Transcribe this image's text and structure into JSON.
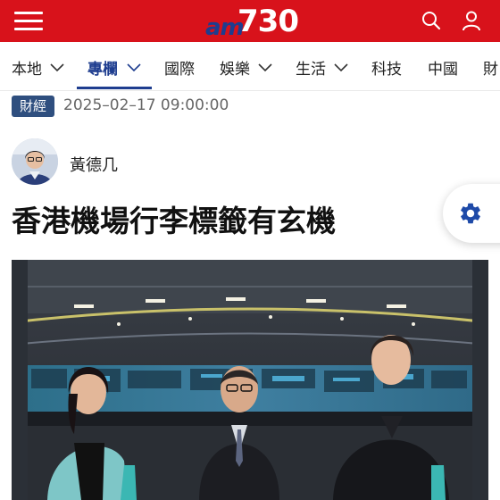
{
  "header": {
    "logo_prefix": "am",
    "logo_number": "730",
    "menu_icon": "hamburger-icon",
    "search_icon": "search-icon",
    "user_icon": "user-icon",
    "brand_color": "#d8121b",
    "logo_blue": "#1e3d8f"
  },
  "nav": {
    "items": [
      {
        "label": "本地",
        "has_dropdown": true
      },
      {
        "label": "專欄",
        "has_dropdown": true,
        "active": true
      },
      {
        "label": "國際",
        "has_dropdown": false
      },
      {
        "label": "娛樂",
        "has_dropdown": true
      },
      {
        "label": "生活",
        "has_dropdown": true
      },
      {
        "label": "科技",
        "has_dropdown": false
      },
      {
        "label": "中國",
        "has_dropdown": false
      },
      {
        "label": "財",
        "has_dropdown": false
      }
    ],
    "active_color": "#1e3d8f"
  },
  "article": {
    "category": "財經",
    "datetime": "2025–02–17 09:00:00",
    "author": "黃德几",
    "title": "香港機場行李標籤有玄機"
  },
  "settings_fab": {
    "icon": "gear-icon"
  }
}
